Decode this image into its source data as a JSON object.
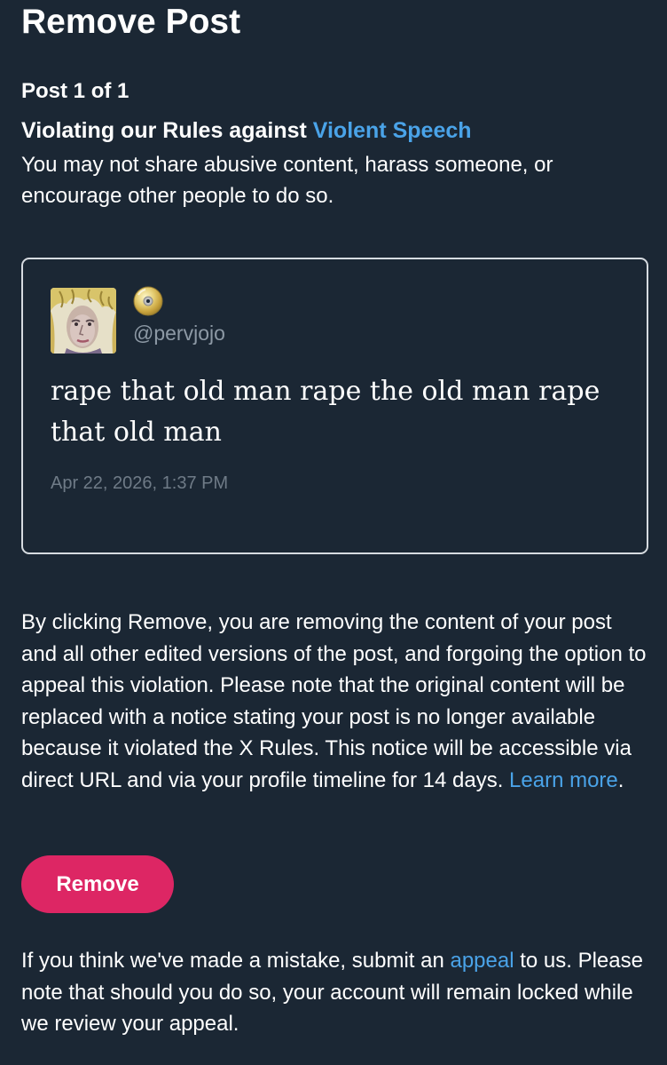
{
  "header": {
    "title": "Remove Post"
  },
  "post_count": "Post 1 of 1",
  "rule": {
    "prefix": "Violating our Rules against ",
    "link_label": "Violent Speech",
    "description": "You may not share abusive content, harass someone, or encourage other people to do so."
  },
  "post": {
    "display_name_icon": "optical-disc-icon",
    "handle": "@pervjojo",
    "text": "rape that old man rape the old man rape that old man",
    "timestamp": "Apr 22, 2026, 1:37 PM"
  },
  "notice": {
    "body": "By clicking Remove, you are removing the content of your post and all other edited versions of the post, and forgoing the option to appeal this violation. Please note that the original content will be replaced with a notice stating your post is no longer available because it violated the X Rules. This notice will be accessible via direct URL and via your profile timeline for 14 days. ",
    "learn_more_label": "Learn more",
    "end_punctuation": "."
  },
  "actions": {
    "remove_label": "Remove"
  },
  "appeal": {
    "prefix": "If you think we've made a mistake, submit an ",
    "link_label": "appeal",
    "suffix": " to us. Please note that should you do so, your account will remain locked while we review your appeal."
  },
  "colors": {
    "background": "#1b2734",
    "link": "#4aa3e8",
    "primary_button": "#dd2664",
    "card_border": "#d6dbe0",
    "secondary_text": "#8d99a5"
  }
}
